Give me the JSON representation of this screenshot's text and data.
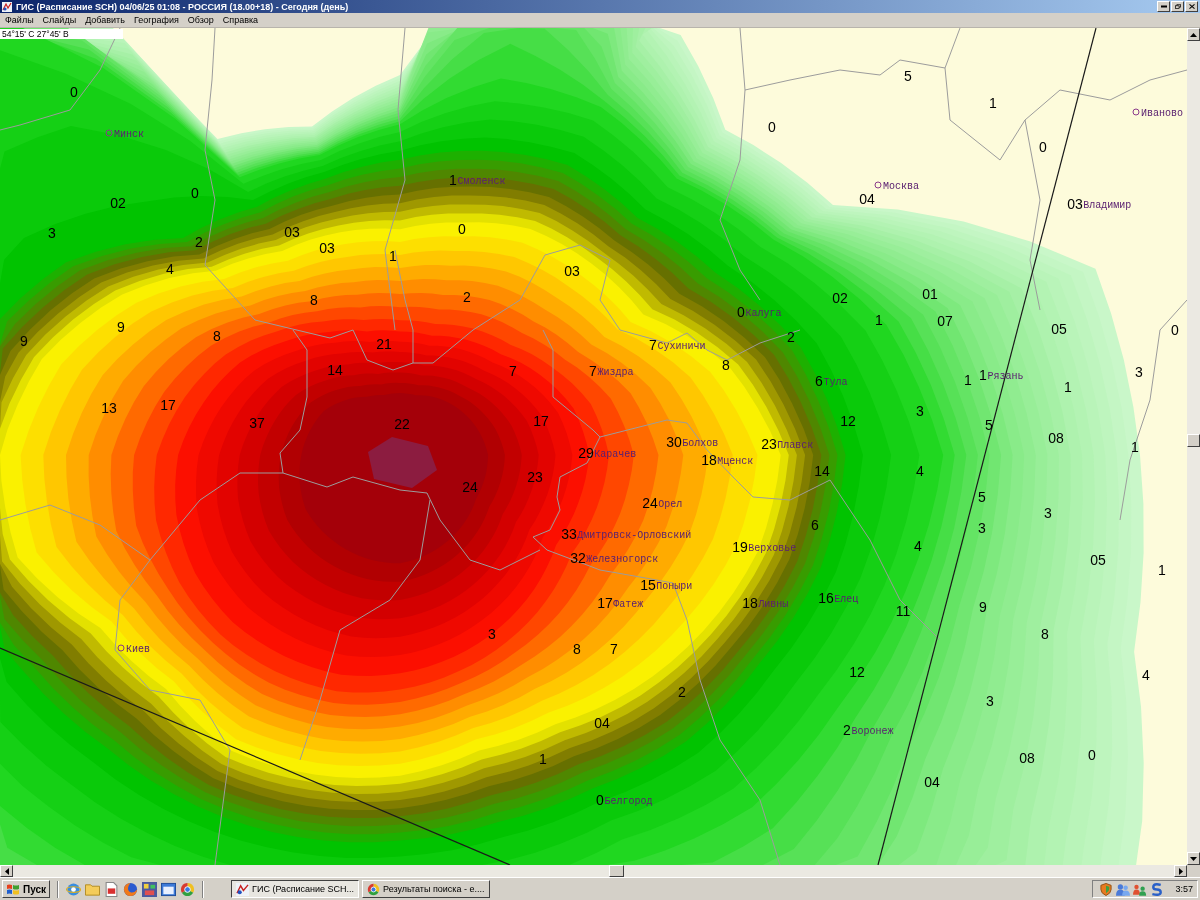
{
  "window": {
    "title": "ГИС (Расписание SCH) 04/06/25 01:08 - РОССИЯ (18.00+18) - Сегодня (день)"
  },
  "menu": [
    "Файлы",
    "Слайды",
    "Добавить",
    "География",
    "Обзор",
    "Справка"
  ],
  "map": {
    "cursor_coordinates": "54°15' С 27°45' В",
    "labels": [
      {
        "value": "5"
      },
      {
        "value": "0"
      },
      {
        "value": "1"
      },
      {
        "city": "Иваново"
      },
      {
        "city": "Минск"
      },
      {
        "value": "0"
      },
      {
        "value": "0"
      },
      {
        "value": "1",
        "city": "Смоленск"
      },
      {
        "city": "Москва"
      },
      {
        "value": "02"
      },
      {
        "value": "0"
      },
      {
        "value": "04"
      },
      {
        "value": "03",
        "city": "Владимир"
      },
      {
        "value": "3"
      },
      {
        "value": "03"
      },
      {
        "value": "0"
      },
      {
        "value": "2"
      },
      {
        "value": "03"
      },
      {
        "value": "1"
      },
      {
        "value": "4"
      },
      {
        "value": "03"
      },
      {
        "value": "8"
      },
      {
        "value": "2"
      },
      {
        "value": "02"
      },
      {
        "value": "01"
      },
      {
        "value": "0",
        "city": "Калуга"
      },
      {
        "value": "9"
      },
      {
        "value": "9"
      },
      {
        "value": "8"
      },
      {
        "value": "2"
      },
      {
        "value": "1"
      },
      {
        "value": "07"
      },
      {
        "value": "05"
      },
      {
        "value": "0"
      },
      {
        "value": "21"
      },
      {
        "value": "7",
        "city": "Сухиничи"
      },
      {
        "value": "14"
      },
      {
        "value": "7"
      },
      {
        "value": "7",
        "city": "Жиздра"
      },
      {
        "value": "8"
      },
      {
        "value": "6",
        "city": "Тула"
      },
      {
        "value": "1"
      },
      {
        "value": "1",
        "city": "Рязань"
      },
      {
        "value": "1"
      },
      {
        "value": "3"
      },
      {
        "value": "13"
      },
      {
        "value": "17"
      },
      {
        "value": "37"
      },
      {
        "value": "22"
      },
      {
        "value": "17"
      },
      {
        "value": "12"
      },
      {
        "value": "3"
      },
      {
        "value": "5"
      },
      {
        "value": "29",
        "city": "Карачев"
      },
      {
        "value": "30",
        "city": "Болхов"
      },
      {
        "value": "18",
        "city": "Мценск"
      },
      {
        "value": "23",
        "city": "Плавск"
      },
      {
        "value": "08"
      },
      {
        "value": "1"
      },
      {
        "value": "23"
      },
      {
        "value": "14"
      },
      {
        "value": "4"
      },
      {
        "value": "24"
      },
      {
        "value": "24",
        "city": "Орел"
      },
      {
        "value": "5"
      },
      {
        "value": "3"
      },
      {
        "value": "33",
        "city": "Дмитровск-Орловский"
      },
      {
        "value": "6"
      },
      {
        "value": "3"
      },
      {
        "value": "32",
        "city": "Железногорск"
      },
      {
        "value": "19",
        "city": "Верховье"
      },
      {
        "value": "4"
      },
      {
        "value": "05"
      },
      {
        "value": "1"
      },
      {
        "value": "15",
        "city": "Поныри"
      },
      {
        "value": "17",
        "city": "Фатеж"
      },
      {
        "value": "18",
        "city": "Ливны"
      },
      {
        "value": "16",
        "city": "Елец"
      },
      {
        "value": "11"
      },
      {
        "value": "9"
      },
      {
        "value": "3"
      },
      {
        "value": "8"
      },
      {
        "city": "Киев"
      },
      {
        "value": "8"
      },
      {
        "value": "7"
      },
      {
        "value": "12"
      },
      {
        "value": "4"
      },
      {
        "value": "2"
      },
      {
        "value": "3"
      },
      {
        "value": "04"
      },
      {
        "value": "2",
        "city": "Воронеж"
      },
      {
        "value": "1"
      },
      {
        "value": "08"
      },
      {
        "value": "0"
      },
      {
        "value": "04"
      },
      {
        "value": "0",
        "city": "Белгород"
      }
    ]
  },
  "taskbar": {
    "start": "Пуск",
    "tasks": [
      {
        "label": "ГИС (Расписание SCH...",
        "selected": true
      },
      {
        "label": "Результаты поиска - е....",
        "selected": false
      }
    ],
    "clock": "3:57"
  }
}
